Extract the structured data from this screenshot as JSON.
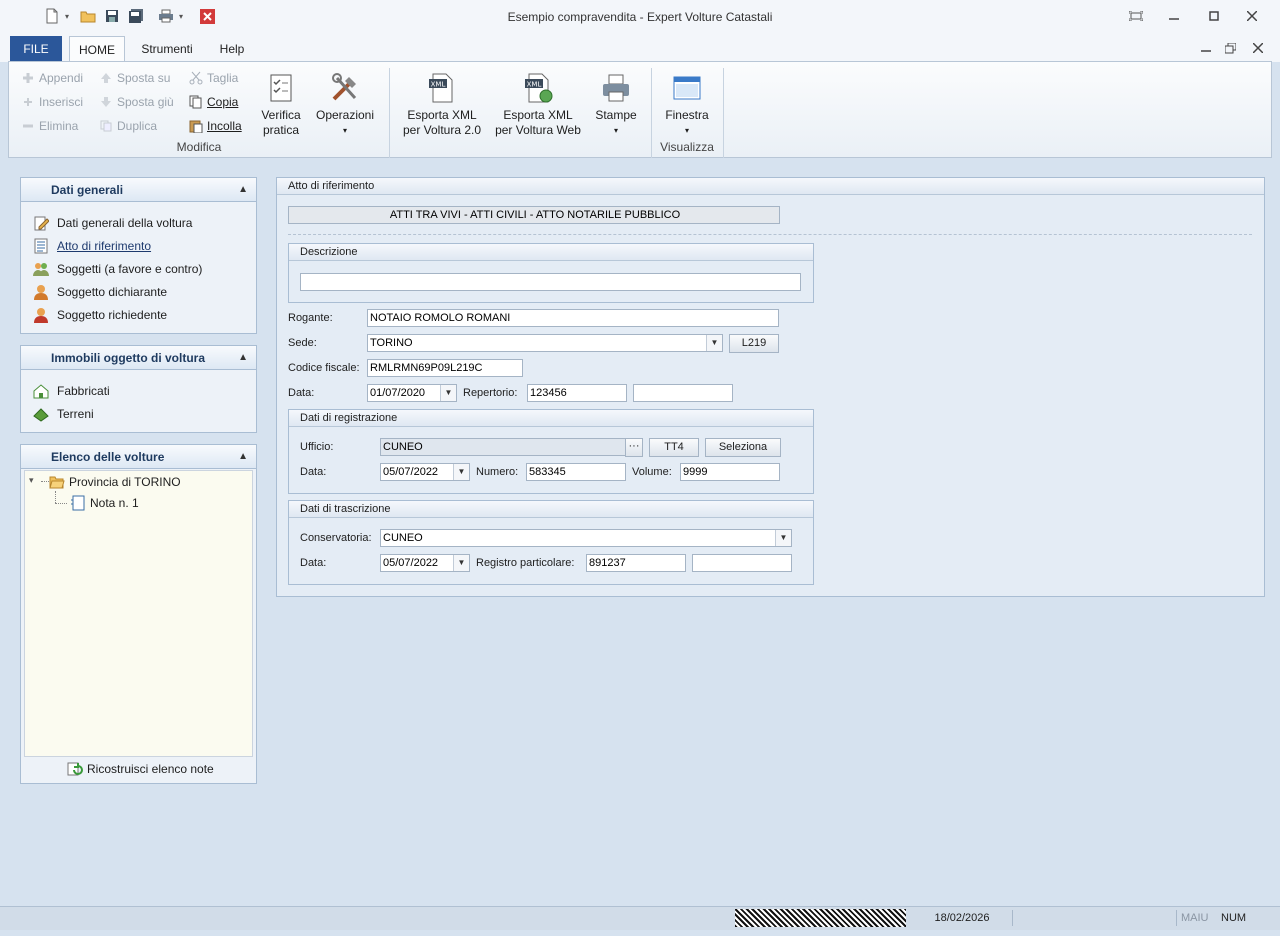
{
  "window": {
    "title": "Esempio compravendita - Expert Volture Catastali"
  },
  "tabs": {
    "file": "FILE",
    "home": "HOME",
    "strumenti": "Strumenti",
    "help": "Help"
  },
  "ribbon": {
    "appendi": "Appendi",
    "inserisci": "Inserisci",
    "elimina": "Elimina",
    "sposta_su": "Sposta su",
    "sposta_giu": "Sposta giù",
    "duplica": "Duplica",
    "taglia": "Taglia",
    "copia": "Copia",
    "incolla": "Incolla",
    "verifica_1": "Verifica",
    "verifica_2": "pratica",
    "operazioni": "Operazioni",
    "esporta20_1": "Esporta XML",
    "esporta20_2": "per Voltura 2.0",
    "esportaweb_1": "Esporta XML",
    "esportaweb_2": "per Voltura Web",
    "stampe": "Stampe",
    "finestra": "Finestra",
    "group_modifica": "Modifica",
    "group_visualizza": "Visualizza",
    "xml_badge": "XML"
  },
  "sidebar": {
    "dati_generali": {
      "title": "Dati generali",
      "items": [
        "Dati generali della voltura",
        "Atto di riferimento",
        "Soggetti (a favore e contro)",
        "Soggetto dichiarante",
        "Soggetto richiedente"
      ]
    },
    "immobili": {
      "title": "Immobili oggetto di voltura",
      "items": [
        "Fabbricati",
        "Terreni"
      ]
    },
    "elenco": {
      "title": "Elenco delle volture",
      "root": "Provincia di TORINO",
      "child": "Nota n. 1",
      "rebuild": "Ricostruisci elenco note"
    }
  },
  "main": {
    "title": "Atto di riferimento",
    "atto_type": "ATTI TRA VIVI - ATTI CIVILI - ATTO NOTARILE PUBBLICO",
    "descrizione": {
      "legend": "Descrizione",
      "value": ""
    },
    "rogante": {
      "label": "Rogante:",
      "value": "NOTAIO ROMOLO ROMANI"
    },
    "sede": {
      "label": "Sede:",
      "value": "TORINO",
      "code": "L219"
    },
    "codice_fiscale": {
      "label": "Codice fiscale:",
      "value": "RMLRMN69P09L219C"
    },
    "data": {
      "label": "Data:",
      "value": "01/07/2020"
    },
    "repertorio": {
      "label": "Repertorio:",
      "value": "123456",
      "extra": ""
    },
    "registrazione": {
      "legend": "Dati di registrazione",
      "ufficio_label": "Ufficio:",
      "ufficio": "CUNEO",
      "ellipsis": "···",
      "code": "TT4",
      "seleziona": "Seleziona",
      "data_label": "Data:",
      "data": "05/07/2022",
      "numero_label": "Numero:",
      "numero": "583345",
      "volume_label": "Volume:",
      "volume": "9999"
    },
    "trascrizione": {
      "legend": "Dati di trascrizione",
      "conservatoria_label": "Conservatoria:",
      "conservatoria": "CUNEO",
      "data_label": "Data:",
      "data": "05/07/2022",
      "registro_label": "Registro particolare:",
      "registro": "891237",
      "extra": ""
    }
  },
  "status": {
    "date": "18/02/2026",
    "maiu": "MAIU",
    "num": "NUM"
  },
  "colors": {
    "accent": "#2b579a",
    "background": "#d6e2ef"
  }
}
